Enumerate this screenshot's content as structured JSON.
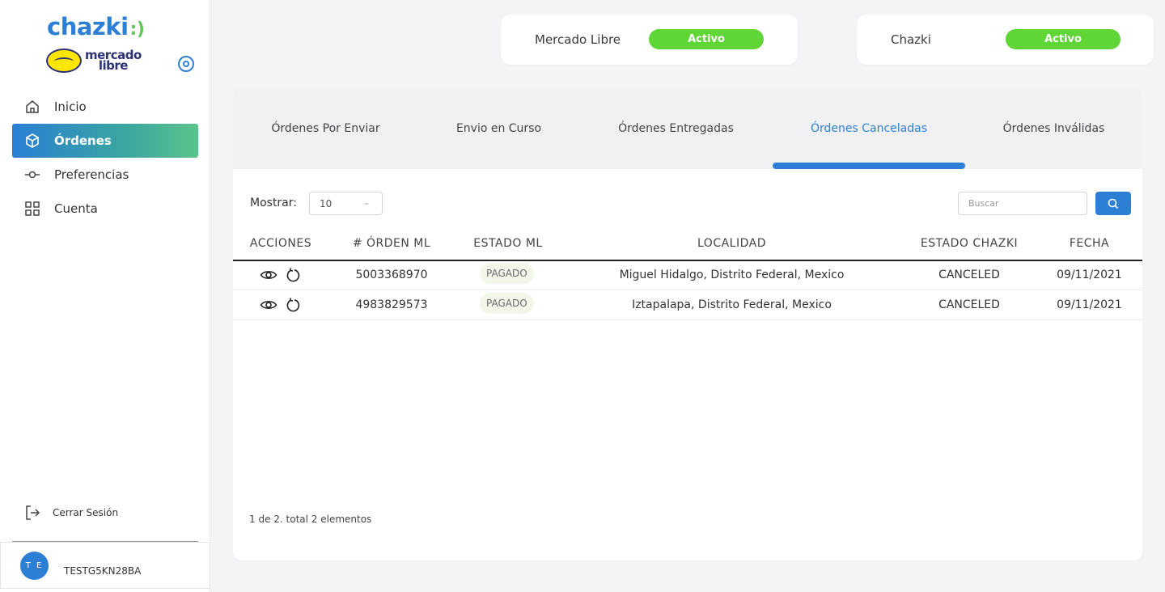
{
  "brand": {
    "chazki_text": "chazki",
    "chazki_tail": ":)",
    "ml_line1": "mercado",
    "ml_line2": "libre"
  },
  "nav": [
    {
      "label": "Inicio",
      "icon": "home-icon"
    },
    {
      "label": "Órdenes",
      "icon": "box-icon",
      "active": true
    },
    {
      "label": "Preferencias",
      "icon": "slider-icon"
    },
    {
      "label": "Cuenta",
      "icon": "grid-icon"
    }
  ],
  "logout_label": "Cerrar Sesión",
  "user": {
    "initials": "T E",
    "name": "TESTG5KN28BA"
  },
  "status_cards": [
    {
      "name": "Mercado Libre",
      "status": "Activo"
    },
    {
      "name": "Chazki",
      "status": "Activo"
    }
  ],
  "colors": {
    "accent": "#2d7fd6",
    "active_green": "#5fd635"
  },
  "tabs": [
    {
      "label": "Órdenes Por Enviar"
    },
    {
      "label": "Envio en Curso"
    },
    {
      "label": "Órdenes Entregadas"
    },
    {
      "label": "Órdenes Canceladas",
      "active": true
    },
    {
      "label": "Órdenes Inválidas"
    }
  ],
  "controls": {
    "show_label": "Mostrar:",
    "page_size": "10",
    "search_placeholder": "Buscar"
  },
  "table": {
    "headers": [
      "ACCIONES",
      "# ÓRDEN ML",
      "ESTADO ML",
      "LOCALIDAD",
      "ESTADO CHAZKI",
      "FECHA"
    ],
    "rows": [
      {
        "order": "5003368970",
        "estado_ml": "PAGADO",
        "localidad": "Miguel Hidalgo, Distrito Federal, Mexico",
        "estado_chazki": "CANCELED",
        "fecha": "09/11/2021"
      },
      {
        "order": "4983829573",
        "estado_ml": "PAGADO",
        "localidad": "Iztapalapa, Distrito Federal, Mexico",
        "estado_chazki": "CANCELED",
        "fecha": "09/11/2021"
      }
    ]
  },
  "pagination_text": "1 de 2. total 2 elementos"
}
